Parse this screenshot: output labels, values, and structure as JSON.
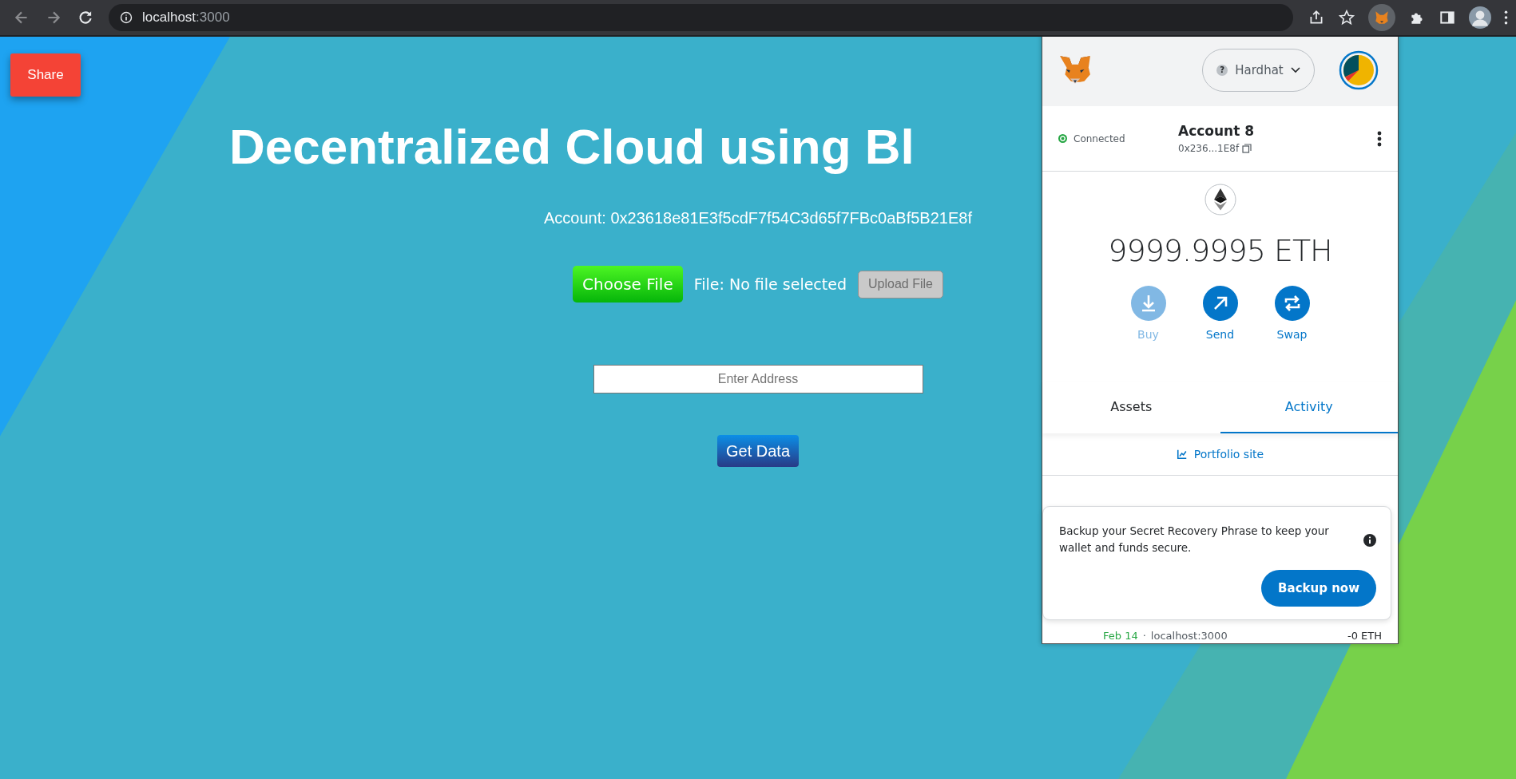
{
  "browser": {
    "url_host": "localhost",
    "url_port": ":3000"
  },
  "share_button": "Share",
  "title": "Decentralized Cloud using Bl",
  "account_label": "Account: 0x23618e81E3f5cdF7f54C3d65f7FBc0aBf5B21E8f",
  "choose_file_button": "Choose File",
  "file_status": "File: No file selected",
  "upload_button": {
    "label": "Upload File",
    "disabled": true
  },
  "address_field": {
    "placeholder": "Enter Address"
  },
  "get_data_button": "Get Data",
  "wallet": {
    "network_badge": "?",
    "network": "Hardhat",
    "connection": {
      "label": "Connected",
      "connected": true
    },
    "account_name": "Account 8",
    "address": "0x236...1E8f",
    "balance": "9999.9995 ETH",
    "actions": [
      {
        "label": "Buy",
        "kind": "buy",
        "disabled": true
      },
      {
        "label": "Send",
        "kind": "send",
        "disabled": false
      },
      {
        "label": "Swap",
        "kind": "swap",
        "disabled": false
      }
    ],
    "tabs": [
      {
        "label": "Assets",
        "selected": false
      },
      {
        "label": "Activity",
        "selected": true
      }
    ],
    "portfolio_link": "Portfolio site",
    "activity": [
      {
        "date": "Feb 14",
        "separator": "·",
        "origin": "localhost:3000",
        "amount": "-0 ETH"
      }
    ],
    "notice": {
      "text": "Backup your Secret Recovery Phrase to keep your wallet and funds secure.",
      "button": "Backup now"
    }
  }
}
